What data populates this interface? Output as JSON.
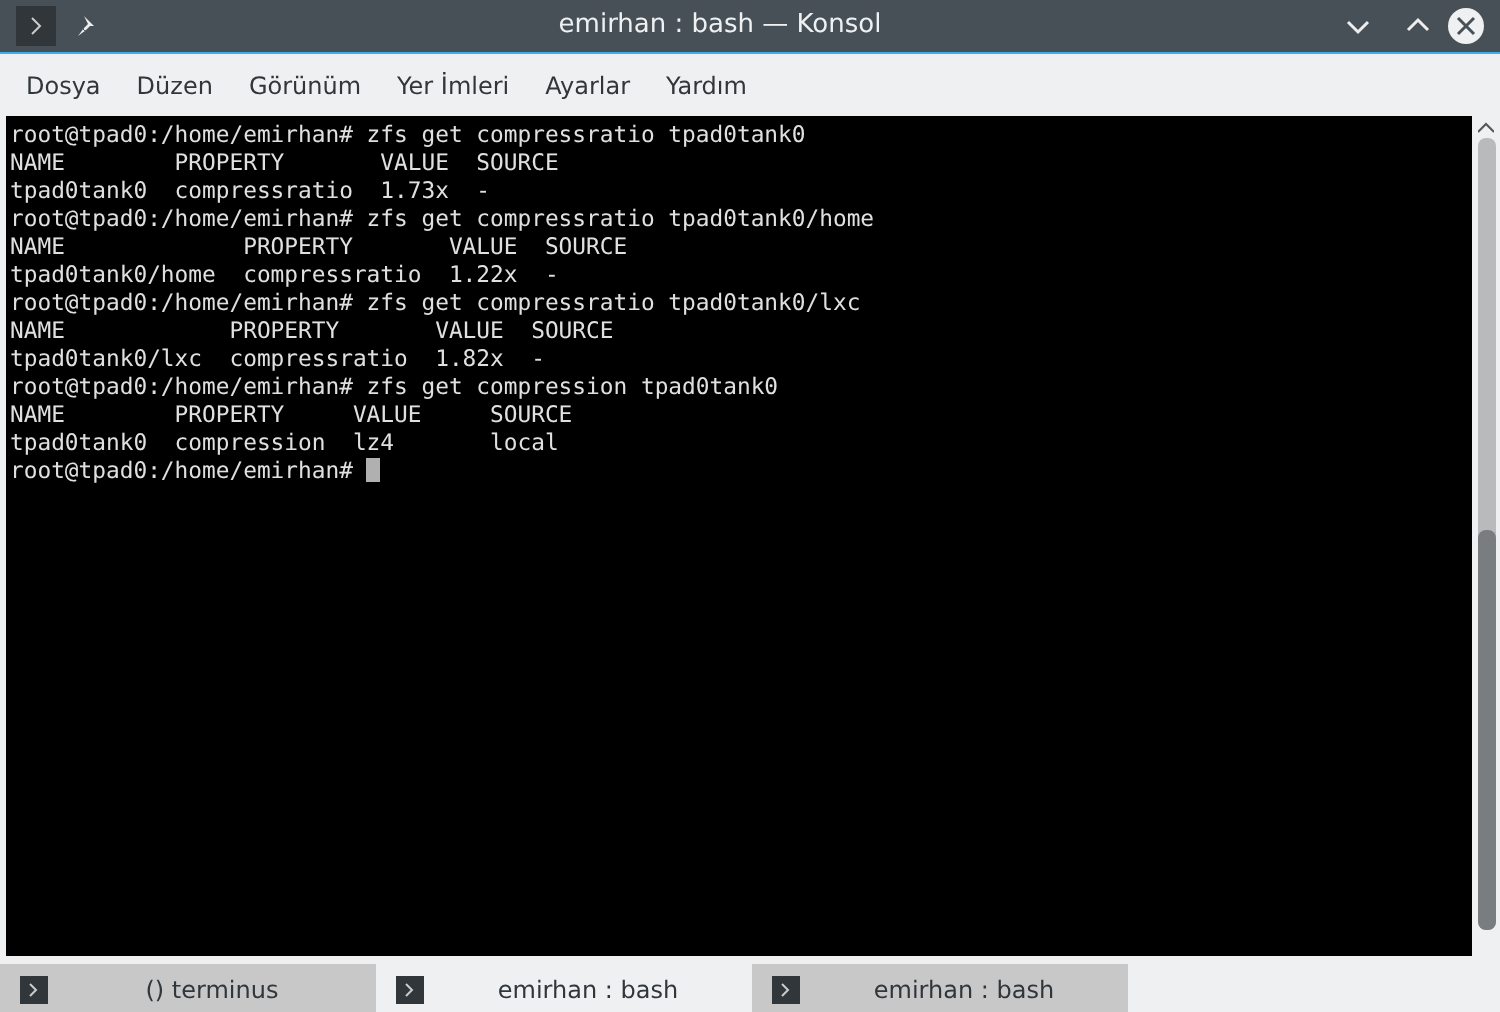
{
  "window": {
    "title": "emirhan : bash — Konsol"
  },
  "menu": [
    "Dosya",
    "Düzen",
    "Görünüm",
    "Yer İmleri",
    "Ayarlar",
    "Yardım"
  ],
  "terminal": {
    "lines": [
      "root@tpad0:/home/emirhan# zfs get compressratio tpad0tank0",
      "NAME        PROPERTY       VALUE  SOURCE",
      "tpad0tank0  compressratio  1.73x  -",
      "root@tpad0:/home/emirhan# zfs get compressratio tpad0tank0/home",
      "NAME             PROPERTY       VALUE  SOURCE",
      "tpad0tank0/home  compressratio  1.22x  -",
      "root@tpad0:/home/emirhan# zfs get compressratio tpad0tank0/lxc",
      "NAME            PROPERTY       VALUE  SOURCE",
      "tpad0tank0/lxc  compressratio  1.82x  -",
      "root@tpad0:/home/emirhan# zfs get compression tpad0tank0",
      "NAME        PROPERTY     VALUE     SOURCE",
      "tpad0tank0  compression  lz4       local",
      "root@tpad0:/home/emirhan# "
    ],
    "cursor": true
  },
  "tabs": [
    {
      "label": "() terminus",
      "selected": false
    },
    {
      "label": "emirhan : bash",
      "selected": true
    },
    {
      "label": "emirhan : bash",
      "selected": false
    }
  ]
}
